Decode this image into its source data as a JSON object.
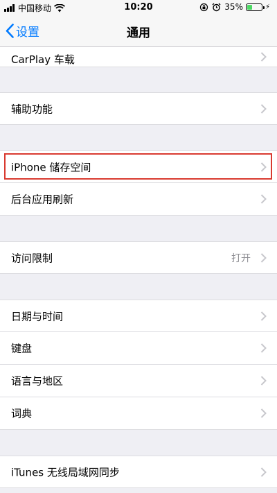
{
  "status_bar": {
    "carrier": "中国移动",
    "time": "10:20",
    "battery_percent": "35%",
    "battery_level": 0.35
  },
  "nav": {
    "back_label": "设置",
    "title": "通用"
  },
  "rows": [
    {
      "label": "CarPlay 车载"
    },
    {
      "label": "辅助功能"
    },
    {
      "label": "iPhone 储存空间"
    },
    {
      "label": "后台应用刷新"
    },
    {
      "label": "访问限制",
      "detail": "打开"
    },
    {
      "label": "日期与时间"
    },
    {
      "label": "键盘"
    },
    {
      "label": "语言与地区"
    },
    {
      "label": "词典"
    },
    {
      "label": "iTunes 无线局域网同步"
    }
  ],
  "colors": {
    "accent": "#007aff",
    "highlight": "#d93a30",
    "battery": "#4cd964",
    "background": "#efeff4"
  }
}
